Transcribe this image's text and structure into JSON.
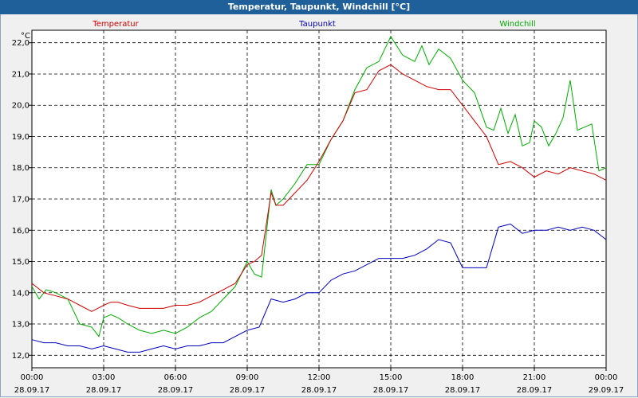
{
  "window": {
    "title": "Temperatur, Taupunkt, Windchill [°C]"
  },
  "colors": {
    "temperature": "#cc0000",
    "dewpoint": "#0000bb",
    "windchill": "#00aa00",
    "grid": "#000000"
  },
  "chart_data": {
    "type": "line",
    "ylabel": "°C",
    "ylim": [
      11.6,
      22.4
    ],
    "y_ticks": [
      "12,0",
      "13,0",
      "14,0",
      "15,0",
      "16,0",
      "17,0",
      "18,0",
      "19,0",
      "20,0",
      "21,0",
      "22,0"
    ],
    "x_range_hours": [
      0,
      24
    ],
    "x_ticks": [
      {
        "time": "00:00",
        "date": "28.09.17"
      },
      {
        "time": "03:00",
        "date": "28.09.17"
      },
      {
        "time": "06:00",
        "date": "28.09.17"
      },
      {
        "time": "09:00",
        "date": "28.09.17"
      },
      {
        "time": "12:00",
        "date": "28.09.17"
      },
      {
        "time": "15:00",
        "date": "28.09.17"
      },
      {
        "time": "18:00",
        "date": "28.09.17"
      },
      {
        "time": "21:00",
        "date": "28.09.17"
      },
      {
        "time": "00:00",
        "date": "29.09.17"
      }
    ],
    "grid": true,
    "legend_placement": "top",
    "series": [
      {
        "name": "Temperatur",
        "x": [
          0,
          0.5,
          1,
          1.5,
          2,
          2.5,
          3,
          3.3,
          3.6,
          4,
          4.5,
          5,
          5.5,
          6,
          6.5,
          7,
          7.5,
          8,
          8.5,
          9,
          9.3,
          9.6,
          10,
          10.2,
          10.5,
          11,
          11.5,
          12,
          12.5,
          13,
          13.5,
          14,
          14.5,
          15,
          15.5,
          16,
          16.5,
          17,
          17.5,
          18,
          18.5,
          19,
          19.5,
          20,
          20.5,
          21,
          21.5,
          22,
          22.5,
          23,
          23.5,
          24
        ],
        "y": [
          14.3,
          14.0,
          13.9,
          13.8,
          13.6,
          13.4,
          13.6,
          13.7,
          13.7,
          13.6,
          13.5,
          13.5,
          13.5,
          13.6,
          13.6,
          13.7,
          13.9,
          14.1,
          14.3,
          14.9,
          15.0,
          15.2,
          17.2,
          16.8,
          16.8,
          17.2,
          17.6,
          18.2,
          18.9,
          19.5,
          20.4,
          20.5,
          21.1,
          21.3,
          21.0,
          20.8,
          20.6,
          20.5,
          20.5,
          20.0,
          19.5,
          19.0,
          18.1,
          18.2,
          18.0,
          17.7,
          17.9,
          17.8,
          18.0,
          17.9,
          17.8,
          17.6
        ]
      },
      {
        "name": "Taupunkt",
        "x": [
          0,
          0.5,
          1,
          1.5,
          2,
          2.5,
          3,
          3.5,
          4,
          4.5,
          5,
          5.5,
          6,
          6.5,
          7,
          7.5,
          8,
          8.5,
          9,
          9.5,
          10,
          10.5,
          11,
          11.5,
          12,
          12.5,
          13,
          13.5,
          14,
          14.5,
          15,
          15.5,
          16,
          16.5,
          17,
          17.5,
          18,
          18.5,
          19,
          19.5,
          20,
          20.5,
          21,
          21.5,
          22,
          22.5,
          23,
          23.5,
          24
        ],
        "y": [
          12.5,
          12.4,
          12.4,
          12.3,
          12.3,
          12.2,
          12.3,
          12.2,
          12.1,
          12.1,
          12.2,
          12.3,
          12.2,
          12.3,
          12.3,
          12.4,
          12.4,
          12.6,
          12.8,
          12.9,
          13.8,
          13.7,
          13.8,
          14.0,
          14.0,
          14.4,
          14.6,
          14.7,
          14.9,
          15.1,
          15.1,
          15.1,
          15.2,
          15.4,
          15.7,
          15.6,
          14.8,
          14.8,
          14.8,
          16.1,
          16.2,
          15.9,
          16.0,
          16.0,
          16.1,
          16.0,
          16.1,
          16.0,
          15.7
        ]
      },
      {
        "name": "Windchill",
        "x": [
          0,
          0.3,
          0.6,
          1,
          1.5,
          2,
          2.5,
          2.8,
          3,
          3.3,
          3.6,
          4,
          4.5,
          5,
          5.5,
          6,
          6.5,
          7,
          7.5,
          8,
          8.5,
          9,
          9.3,
          9.6,
          10,
          10.2,
          10.5,
          11,
          11.5,
          12,
          12.5,
          13,
          13.5,
          14,
          14.5,
          15,
          15.5,
          16,
          16.3,
          16.6,
          17,
          17.5,
          18,
          18.5,
          19,
          19.3,
          19.6,
          19.9,
          20.2,
          20.5,
          20.8,
          21,
          21.3,
          21.6,
          21.9,
          22.2,
          22.5,
          22.8,
          23.1,
          23.4,
          23.7,
          24
        ],
        "y": [
          14.2,
          13.8,
          14.1,
          14.0,
          13.8,
          13.0,
          12.9,
          12.6,
          13.2,
          13.3,
          13.2,
          13.0,
          12.8,
          12.7,
          12.8,
          12.7,
          12.9,
          13.2,
          13.4,
          13.8,
          14.2,
          15.0,
          14.6,
          14.5,
          17.3,
          16.8,
          17.0,
          17.5,
          18.1,
          18.1,
          18.9,
          19.5,
          20.5,
          21.2,
          21.4,
          22.2,
          21.6,
          21.4,
          21.9,
          21.3,
          21.8,
          21.5,
          20.8,
          20.4,
          19.3,
          19.2,
          19.9,
          19.1,
          19.7,
          18.7,
          18.8,
          19.5,
          19.3,
          18.7,
          19.1,
          19.6,
          20.8,
          19.2,
          19.3,
          19.4,
          17.9,
          18.0
        ]
      }
    ]
  }
}
